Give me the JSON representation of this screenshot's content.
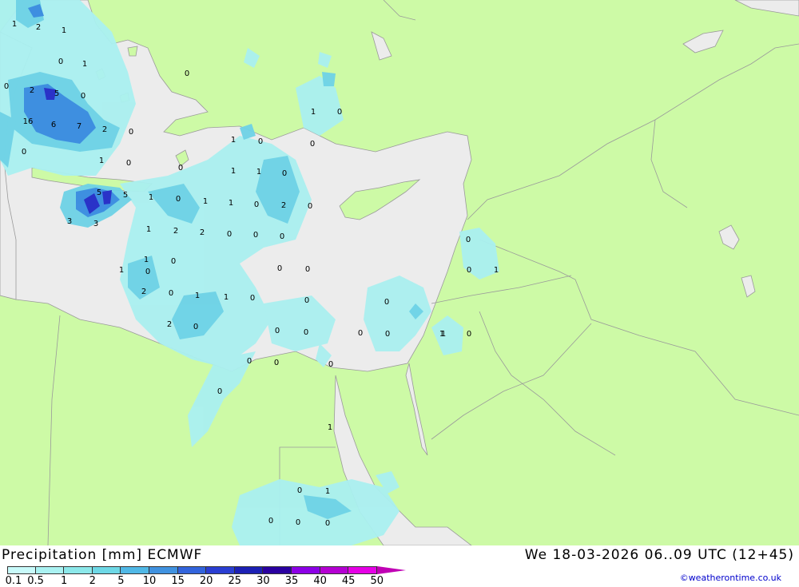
{
  "header": {
    "title": "Precipitation [mm] ECMWF",
    "valid_time": "We 18-03-2026 06..09 UTC (12+45)"
  },
  "legend": {
    "levels": [
      "0.1",
      "0.5",
      "1",
      "2",
      "5",
      "10",
      "15",
      "20",
      "25",
      "30",
      "35",
      "40",
      "45",
      "50"
    ],
    "colors": [
      "#c8fafa",
      "#aaf2f2",
      "#8ce8ea",
      "#6ed8e6",
      "#50b8e6",
      "#4092e0",
      "#3264dc",
      "#2a3ed2",
      "#1c20b4",
      "#2a00a0",
      "#8c00e6",
      "#b400d2",
      "#e600e6",
      "#c000b4"
    ]
  },
  "credit": "©weatherontime.co.uk",
  "colors": {
    "land": "#cdfaa6",
    "sea": "#ececec",
    "light_precip": "#aaf0f0",
    "medium_precip": "#6ed2e6",
    "heavy_precip": "#3c8ce0",
    "very_heavy_precip": "#2a32c8"
  },
  "map_values": [
    "1",
    "2",
    "1",
    "0",
    "1",
    "0",
    "0",
    "2",
    "5",
    "0",
    "16",
    "6",
    "7",
    "2",
    "0",
    "0",
    "1",
    "0",
    "0",
    "1",
    "0",
    "0",
    "1",
    "0",
    "1",
    "1",
    "0",
    "1",
    "0",
    "5",
    "5",
    "3",
    "3",
    "1",
    "2",
    "1",
    "1",
    "0",
    "2",
    "0",
    "1",
    "0",
    "2",
    "0",
    "0",
    "0",
    "1",
    "0",
    "0",
    "0",
    "2",
    "0",
    "1",
    "1",
    "0",
    "0",
    "0",
    "2",
    "0",
    "0",
    "0",
    "0",
    "0",
    "0",
    "0",
    "0",
    "0",
    "1",
    "0",
    "1",
    "0",
    "1",
    "0",
    "1",
    "0",
    "1",
    "0",
    "0",
    "0"
  ]
}
